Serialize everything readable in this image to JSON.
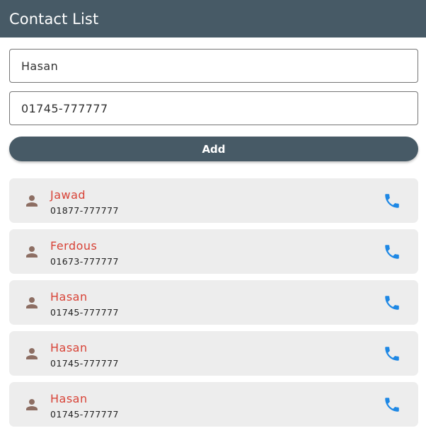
{
  "app_bar": {
    "title": "Contact List"
  },
  "form": {
    "name_value": "Hasan",
    "phone_value": "01745-777777",
    "add_label": "Add"
  },
  "contacts": [
    {
      "name": "Jawad",
      "phone": "01877-777777"
    },
    {
      "name": "Ferdous",
      "phone": "01673-777777"
    },
    {
      "name": "Hasan",
      "phone": "01745-777777"
    },
    {
      "name": "Hasan",
      "phone": "01745-777777"
    },
    {
      "name": "Hasan",
      "phone": "01745-777777"
    }
  ],
  "icons": {
    "leading": "person-icon",
    "trailing": "phone-icon"
  },
  "colors": {
    "app_bar": "#475a66",
    "name_text": "#d84236",
    "person_icon": "#8d6e63",
    "phone_icon": "#1e88e5",
    "card_bg": "#ededed"
  }
}
